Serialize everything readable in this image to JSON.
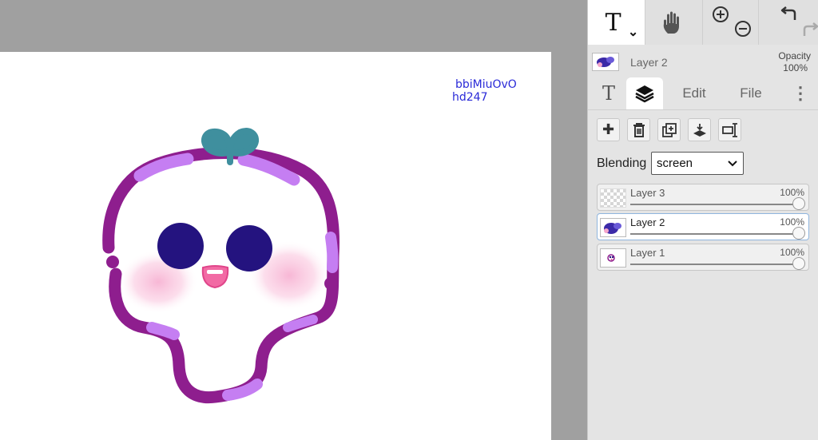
{
  "canvas": {
    "signature_line1": "bbiMiuOvO",
    "signature_line2": "hd247"
  },
  "toolbar": {
    "text_tool_glyph": "T",
    "dropdown_glyph": "⌄"
  },
  "layer_info": {
    "name": "Layer 2",
    "opacity_label": "Opacity",
    "opacity_value": "100%"
  },
  "tabs": [
    {
      "label": "T",
      "icon": "text-icon"
    },
    {
      "label": "",
      "icon": "layers-icon"
    },
    {
      "label": "Edit"
    },
    {
      "label": "File"
    },
    {
      "label": "⋮",
      "icon": "more-icon"
    }
  ],
  "layer_actions": [
    {
      "icon": "plus-icon",
      "glyph": "✚"
    },
    {
      "icon": "trash-icon"
    },
    {
      "icon": "duplicate-icon"
    },
    {
      "icon": "merge-down-icon"
    },
    {
      "icon": "rename-icon"
    }
  ],
  "blending": {
    "label": "Blending",
    "selected": "screen",
    "options": [
      "screen"
    ]
  },
  "layers": [
    {
      "name": "Layer 3",
      "opacity": "100%",
      "opacity_fraction": 1.0
    },
    {
      "name": "Layer 2",
      "opacity": "100%",
      "opacity_fraction": 1.0,
      "selected": true
    },
    {
      "name": "Layer 1",
      "opacity": "100%",
      "opacity_fraction": 1.0
    }
  ],
  "colors": {
    "workspace": "#a0a0a0",
    "panel": "#e4e4e4",
    "outline_dark": "#8e1e8e",
    "outline_light": "#c57ef2",
    "eyes": "#24137f",
    "sprout": "#3f8f9e",
    "blush": "#f8bfd9",
    "signature": "#2a2ad8"
  }
}
